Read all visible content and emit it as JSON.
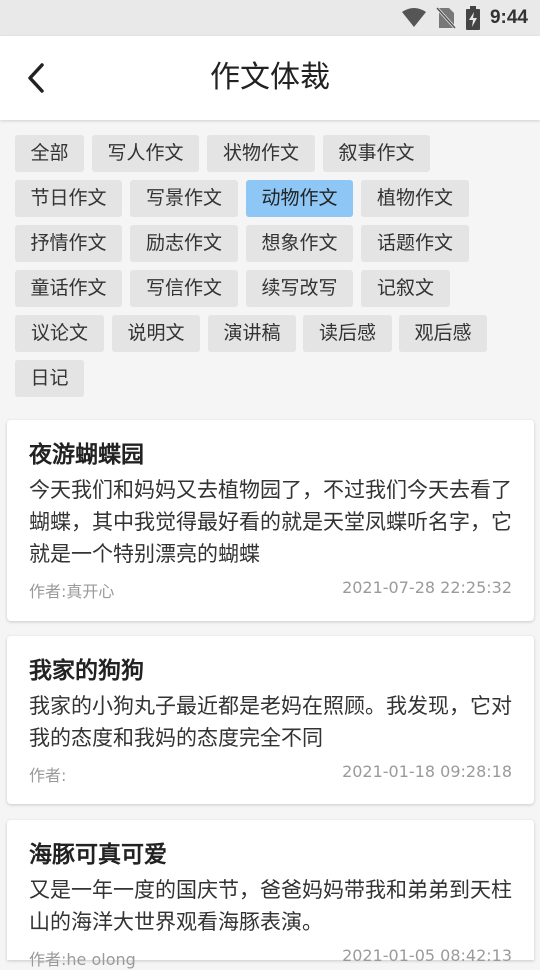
{
  "status_bar": {
    "time": "9:44"
  },
  "header": {
    "title": "作文体裁"
  },
  "tags": [
    {
      "label": "全部"
    },
    {
      "label": "写人作文"
    },
    {
      "label": "状物作文"
    },
    {
      "label": "叙事作文"
    },
    {
      "label": "节日作文"
    },
    {
      "label": "写景作文"
    },
    {
      "label": "动物作文",
      "active": true
    },
    {
      "label": "植物作文"
    },
    {
      "label": "抒情作文"
    },
    {
      "label": "励志作文"
    },
    {
      "label": "想象作文"
    },
    {
      "label": "话题作文"
    },
    {
      "label": "童话作文"
    },
    {
      "label": "写信作文"
    },
    {
      "label": "续写改写"
    },
    {
      "label": "记叙文"
    },
    {
      "label": "议论文"
    },
    {
      "label": "说明文"
    },
    {
      "label": "演讲稿"
    },
    {
      "label": "读后感"
    },
    {
      "label": "观后感"
    },
    {
      "label": "日记"
    }
  ],
  "articles": [
    {
      "title": "夜游蝴蝶园",
      "summary": " 今天我们和妈妈又去植物园了，不过我们今天去看了蝴蝶，其中我觉得最好看的就是天堂凤蝶听名字，它就是一个特别漂亮的蝴蝶",
      "author": "作者:真开心",
      "date": "2021-07-28 22:25:32"
    },
    {
      "title": "我家的狗狗",
      "summary": "我家的小狗丸子最近都是老妈在照顾。我发现，它对我的态度和我妈的态度完全不同",
      "author": "作者:",
      "date": "2021-01-18 09:28:18"
    },
    {
      "title": "海豚可真可爱",
      "summary": "又是一年一度的国庆节，爸爸妈妈带我和弟弟到天柱山的海洋大世界观看海豚表演。",
      "author": "作者:he olong",
      "date": "2021-01-05 08:42:13"
    }
  ],
  "colors": {
    "active_tag": "#8ec6f5",
    "tag_bg": "#e4e4e4"
  }
}
